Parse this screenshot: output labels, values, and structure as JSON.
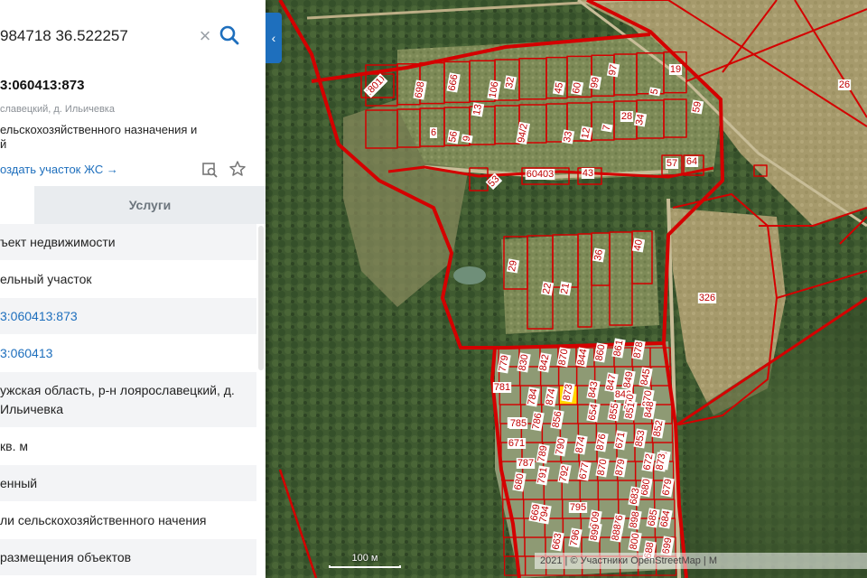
{
  "search": {
    "value": "984718 36.522257"
  },
  "parcel": {
    "cad_number": "3:060413:873",
    "address_short": "славецкий, д. Ильичевка",
    "purpose_line1": "ельскохозяйственного назначения и",
    "purpose_line2": "й",
    "create_link": "оздать участок ЖС →"
  },
  "tabs": {
    "services": "Услуги"
  },
  "rows": [
    "ъект недвижимости",
    "ельный участок",
    "3:060413:873",
    "3:060413",
    "ужская область, р-н лоярославецкий, д. Ильичевка",
    "кв. м",
    "енный",
    "ли сельскохозяйственного начения",
    "размещения объектов"
  ],
  "map": {
    "scale_label": "100 м",
    "attribution": "2021 | © Участники OpenStreetMap | M",
    "boundary_color": "#d40000",
    "selected_color": "#ffd800",
    "plot_labels": [
      "1800",
      "14",
      "10",
      "13",
      "106",
      "32",
      "45",
      "60",
      "99",
      "97",
      "5",
      "19",
      "59",
      "6",
      "56",
      "9",
      "94/2",
      "33",
      "12",
      "7",
      "28",
      "34",
      "26",
      "53",
      "60403",
      "43",
      "57",
      "64",
      "29",
      "36",
      "40",
      "22",
      "21",
      "326",
      "779",
      "830",
      "842",
      "870",
      "844",
      "860",
      "861",
      "878",
      "781",
      "784",
      "874",
      "873",
      "843",
      "847",
      "849",
      "845",
      "846",
      "850",
      "870",
      "783",
      "785",
      "786",
      "856",
      "654",
      "855",
      "851",
      "848",
      "852",
      "671",
      "787",
      "789",
      "790",
      "874",
      "876",
      "671",
      "853",
      "854",
      "672",
      "873",
      "680",
      "791",
      "792",
      "677",
      "870",
      "879",
      "680",
      "683",
      "679",
      "669",
      "794",
      "795",
      "809",
      "676",
      "898",
      "685",
      "684",
      "663",
      "796",
      "899",
      "888",
      "800",
      "688",
      "699",
      "801",
      "698",
      "666"
    ]
  }
}
